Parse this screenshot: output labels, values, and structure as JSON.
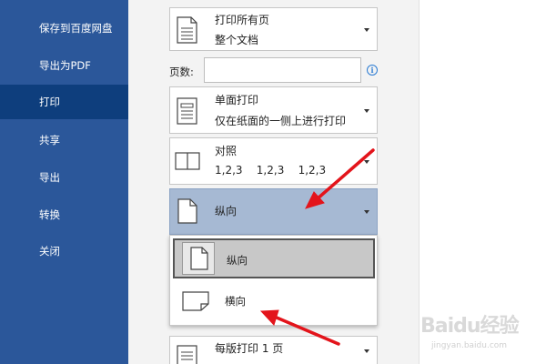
{
  "sidebar": {
    "items": [
      {
        "label": "保存到百度网盘"
      },
      {
        "label": "导出为PDF"
      },
      {
        "label": "打印"
      },
      {
        "label": "共享"
      },
      {
        "label": "导出"
      },
      {
        "label": "转换"
      },
      {
        "label": "关闭"
      }
    ]
  },
  "print_settings": {
    "range": {
      "title": "打印所有页",
      "subtitle": "整个文档"
    },
    "pages": {
      "label": "页数:",
      "value": "",
      "placeholder": "",
      "info_icon": "info-icon"
    },
    "sides": {
      "title": "单面打印",
      "subtitle": "仅在纸面的一侧上进行打印"
    },
    "collate": {
      "title": "对照",
      "subtitle": "1,2,3    1,2,3    1,2,3"
    },
    "orientation": {
      "selected": "纵向",
      "options": [
        {
          "label": "纵向",
          "icon": "portrait-page-icon"
        },
        {
          "label": "横向",
          "icon": "landscape-page-icon"
        }
      ]
    },
    "pages_per_sheet": {
      "title": "每版打印 1 页"
    }
  },
  "colors": {
    "sidebar_bg": "#2b579a",
    "sidebar_active": "#0e3e7d",
    "orientation_highlight": "#a6b9d3",
    "annotation_arrow": "#e3141b"
  },
  "watermark": {
    "brand": "Baidu经验",
    "sub": "jingyan.baidu.com"
  }
}
